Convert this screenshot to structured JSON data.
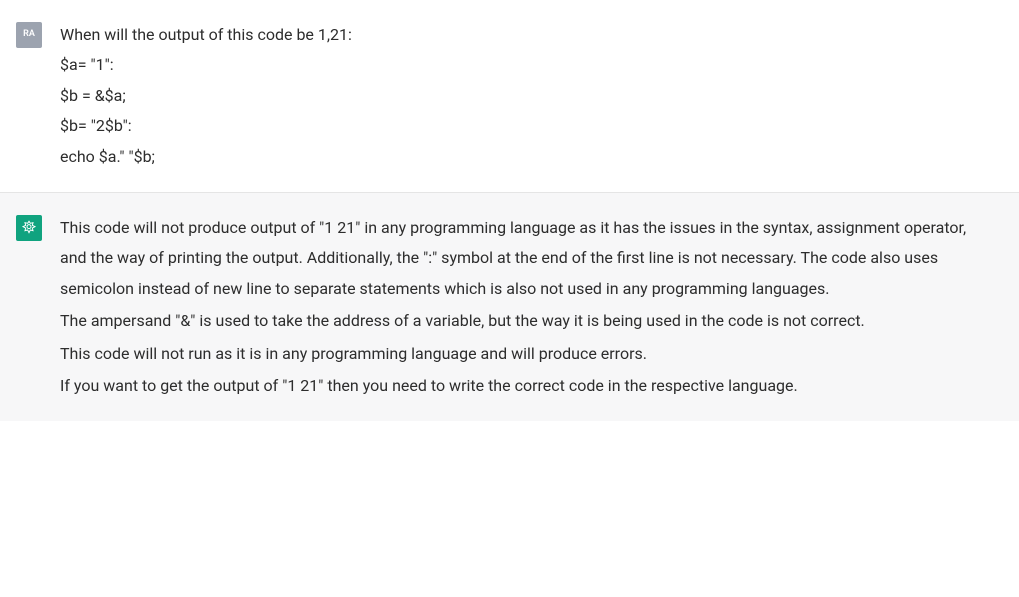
{
  "user": {
    "avatar_label": "RA",
    "lines": [
      "When will the output of this code be 1,21:",
      "$a= \"1\":",
      "$b = &$a;",
      "$b= \"2$b\":",
      "echo $a.\" \"$b;"
    ]
  },
  "assistant": {
    "lines": [
      "This code will not produce output of \"1 21\" in any programming language as it has the issues in the syntax, assignment operator, and the way of printing the output. Additionally, the \":\" symbol at the end of the first line is not necessary. The code also uses semicolon instead of new line to separate statements which is also not used in any programming languages.",
      "The ampersand \"&\" is used to take the address of a variable, but the way it is being used in the code is not correct.",
      "This code will not run as it is in any programming language and will produce errors.",
      "If you want to get the output of \"1 21\" then you need to write the correct code in the respective language."
    ]
  }
}
